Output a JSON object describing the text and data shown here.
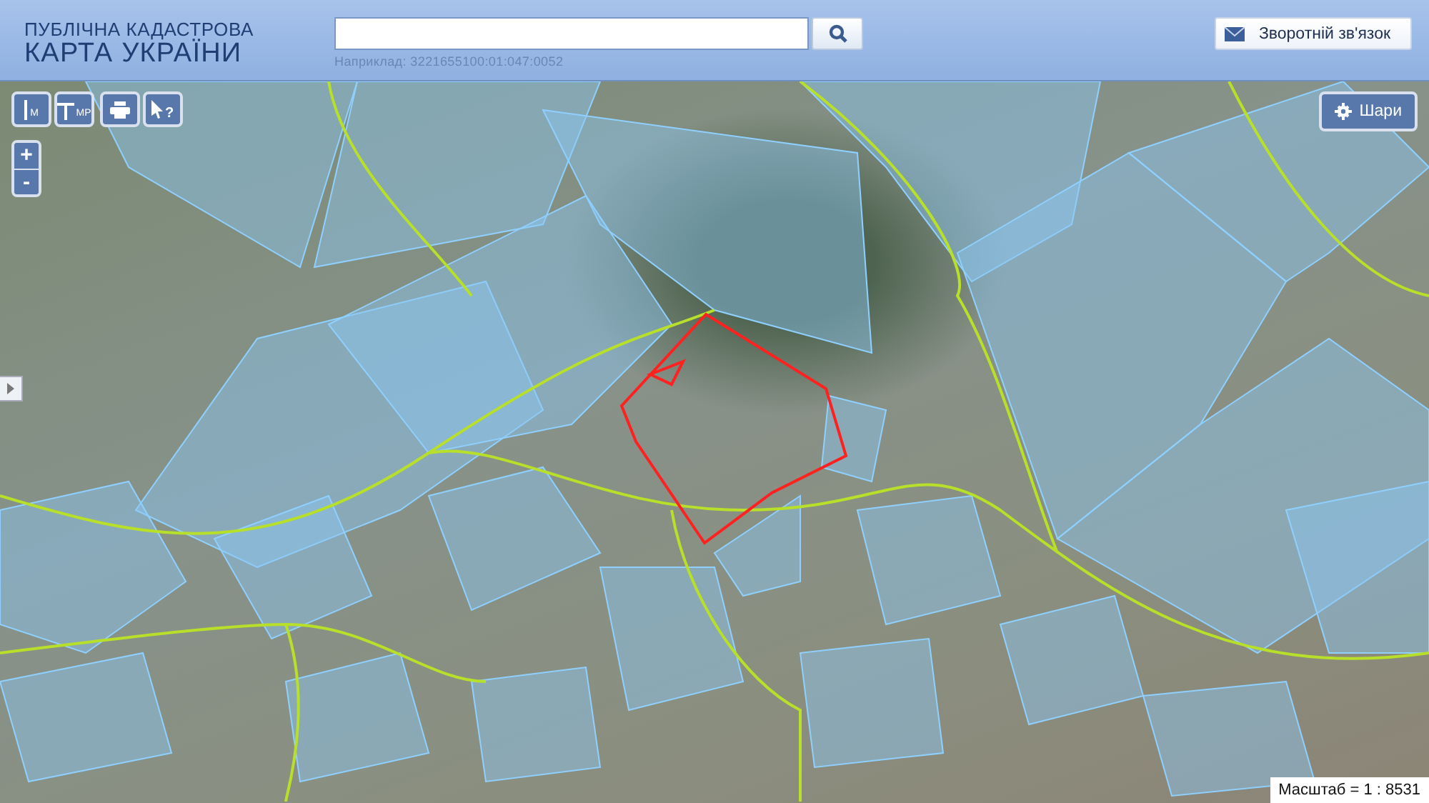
{
  "header": {
    "title_line1": "ПУБЛІЧНА КАДАСТРОВА",
    "title_line2": "КАРТА УКРАЇНИ"
  },
  "search": {
    "hint": "Наприклад: 3221655100:01:047:0052"
  },
  "feedback_button": {
    "label": "Зворотній зв'язок"
  },
  "tools": [
    {
      "kind": "length",
      "label": "М"
    },
    {
      "kind": "area",
      "label": "МР"
    },
    {
      "kind": "print"
    },
    {
      "kind": "identify",
      "label": "?"
    }
  ],
  "zoom": {
    "in": "+",
    "out": "-"
  },
  "layers_button": {
    "label": "Шари"
  },
  "scale": "Масштаб = 1 : 8531"
}
